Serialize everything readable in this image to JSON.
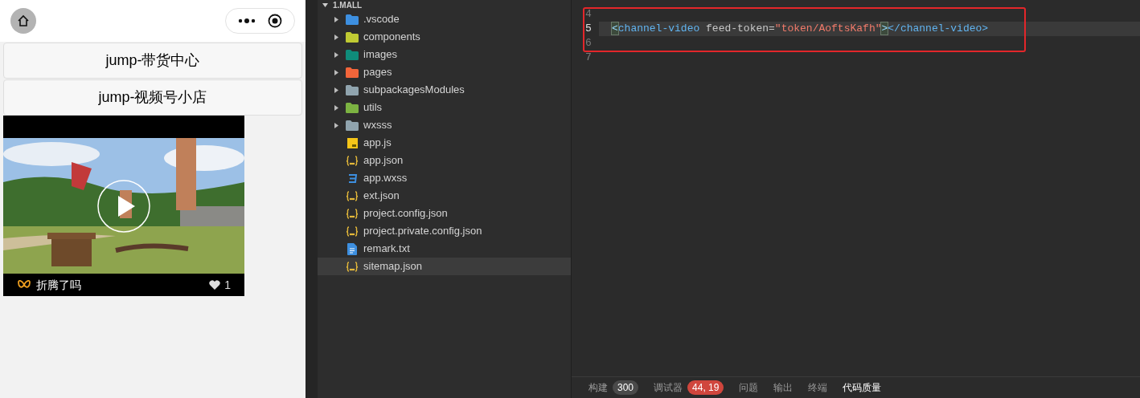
{
  "phone": {
    "buttons": [
      "jump-带货中心",
      "jump-视频号小店"
    ],
    "video": {
      "author": "折腾了吗",
      "likes": "1"
    }
  },
  "explorer": {
    "title": "1.MALL",
    "items": [
      {
        "name": ".vscode",
        "kind": "folder",
        "color": "#3d8fe0",
        "selected": false
      },
      {
        "name": "components",
        "kind": "folder",
        "color": "#c0ca33",
        "selected": false
      },
      {
        "name": "images",
        "kind": "folder",
        "color": "#0f8c7a",
        "selected": false
      },
      {
        "name": "pages",
        "kind": "folder",
        "color": "#f2653a",
        "selected": false
      },
      {
        "name": "subpackagesModules",
        "kind": "folder",
        "color": "#90a4ae",
        "selected": false
      },
      {
        "name": "utils",
        "kind": "folder",
        "color": "#7cb342",
        "selected": false
      },
      {
        "name": "wxsss",
        "kind": "folder",
        "color": "#90a4ae",
        "selected": false
      },
      {
        "name": "app.js",
        "kind": "js",
        "selected": false
      },
      {
        "name": "app.json",
        "kind": "json",
        "selected": false
      },
      {
        "name": "app.wxss",
        "kind": "css",
        "selected": false
      },
      {
        "name": "ext.json",
        "kind": "json",
        "selected": false
      },
      {
        "name": "project.config.json",
        "kind": "json",
        "selected": false
      },
      {
        "name": "project.private.config.json",
        "kind": "json",
        "selected": false
      },
      {
        "name": "remark.txt",
        "kind": "txt",
        "selected": false
      },
      {
        "name": "sitemap.json",
        "kind": "json",
        "selected": true
      }
    ]
  },
  "editor": {
    "lines": [
      {
        "number": "4",
        "current": false
      },
      {
        "number": "5",
        "current": true,
        "tokens": [
          {
            "kind": "bracket",
            "text": "<"
          },
          {
            "kind": "tag",
            "text": "channel-video"
          },
          {
            "kind": "attr",
            "text": " feed-token="
          },
          {
            "kind": "string",
            "text": "\"token/AoftsKafh\""
          },
          {
            "kind": "bracket",
            "text": ">"
          },
          {
            "kind": "tag",
            "text": "</channel-video>"
          }
        ]
      },
      {
        "number": "6",
        "current": false
      },
      {
        "number": "7",
        "current": false
      }
    ]
  },
  "panel_tabs": [
    {
      "label": "构建",
      "badge": "300",
      "color": "#4a4a4a",
      "selected": false
    },
    {
      "label": "调试器",
      "badge": "44, 19",
      "color": "#d0463d",
      "selected": false
    },
    {
      "label": "问题",
      "selected": false
    },
    {
      "label": "输出",
      "selected": false
    },
    {
      "label": "终端",
      "selected": false
    },
    {
      "label": "代码质量",
      "selected": true
    }
  ]
}
